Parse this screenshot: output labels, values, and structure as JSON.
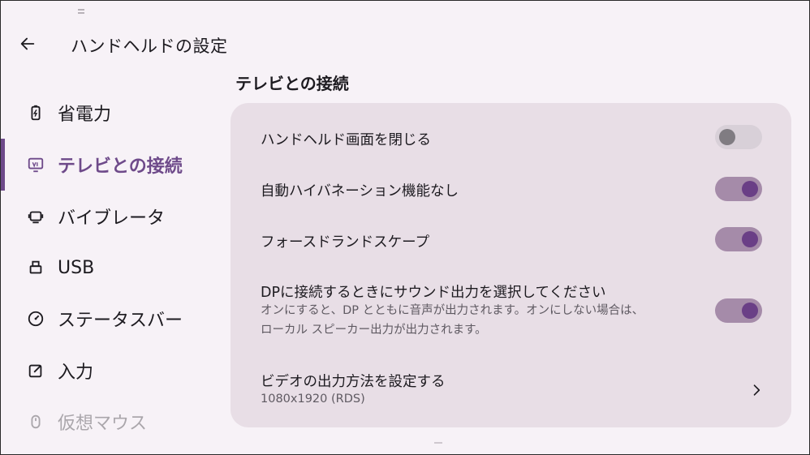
{
  "header": {
    "title": "ハンドヘルドの設定"
  },
  "sidebar": {
    "items": [
      {
        "label": "省電力",
        "icon": "battery-icon"
      },
      {
        "label": "テレビとの接続",
        "icon": "tv-cast-icon",
        "active": true
      },
      {
        "label": "バイブレータ",
        "icon": "vibration-icon"
      },
      {
        "label": "USB",
        "icon": "usb-icon"
      },
      {
        "label": "ステータスバー",
        "icon": "speedometer-icon"
      },
      {
        "label": "入力",
        "icon": "edit-icon"
      },
      {
        "label": "仮想マウス",
        "icon": "mouse-icon"
      }
    ]
  },
  "section": {
    "title": "テレビとの接続"
  },
  "settings": [
    {
      "title": "ハンドヘルド画面を閉じる",
      "toggle": "off"
    },
    {
      "title": "自動ハイバネーション機能なし",
      "toggle": "on"
    },
    {
      "title": "フォースドランドスケープ",
      "toggle": "on"
    },
    {
      "title": "DPに接続するときにサウンド出力を選択してください",
      "subtitle_line1": "オンにすると、DP とともに音声が出力されます。オンにしない場合は、",
      "subtitle_line2": "ローカル スピーカー出力が出力されます。",
      "toggle": "on"
    },
    {
      "title": "ビデオの出力方法を設定する",
      "subtitle": "1080x1920 (RDS)",
      "action": "chevron-right-icon"
    }
  ],
  "colors": {
    "accent": "#6e4a8a",
    "card_bg": "#e8dee6",
    "page_bg": "#f7f2f7",
    "switch_on_track": "#a58ba9",
    "switch_on_knob": "#6a3f86"
  }
}
